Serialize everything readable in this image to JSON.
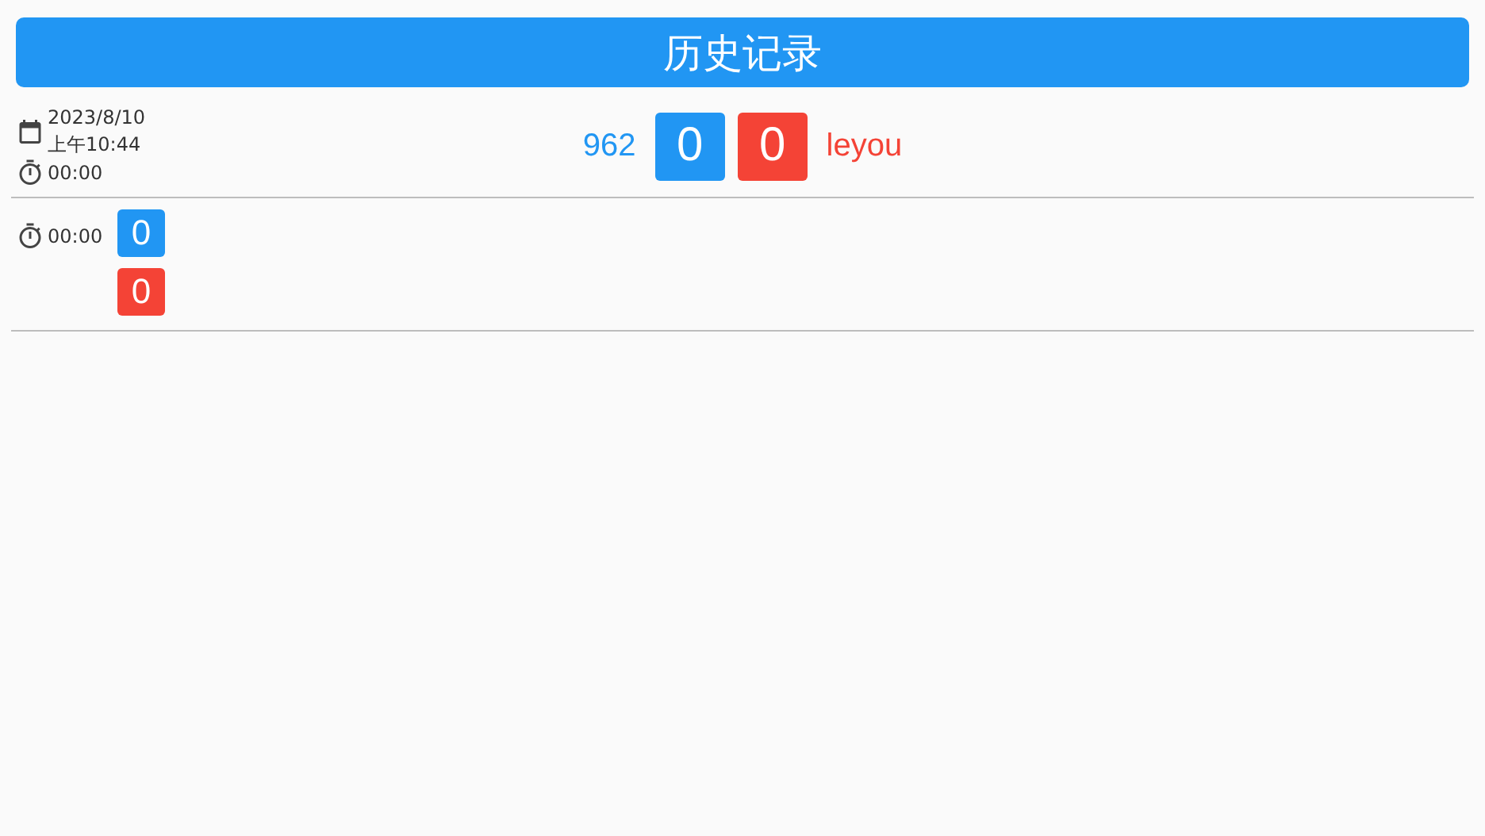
{
  "header": {
    "title": "历史记录"
  },
  "match": {
    "date": "2023/8/10",
    "time": "上午10:44",
    "duration": "00:00",
    "teams": [
      {
        "name": "962",
        "score": "0",
        "color": "#2196f3"
      },
      {
        "name": "leyou",
        "score": "0",
        "color": "#f44336"
      }
    ]
  },
  "rounds": [
    {
      "duration": "00:00",
      "scores": [
        {
          "score": "0",
          "color": "#2196f3"
        },
        {
          "score": "0",
          "color": "#f44336"
        }
      ]
    }
  ]
}
